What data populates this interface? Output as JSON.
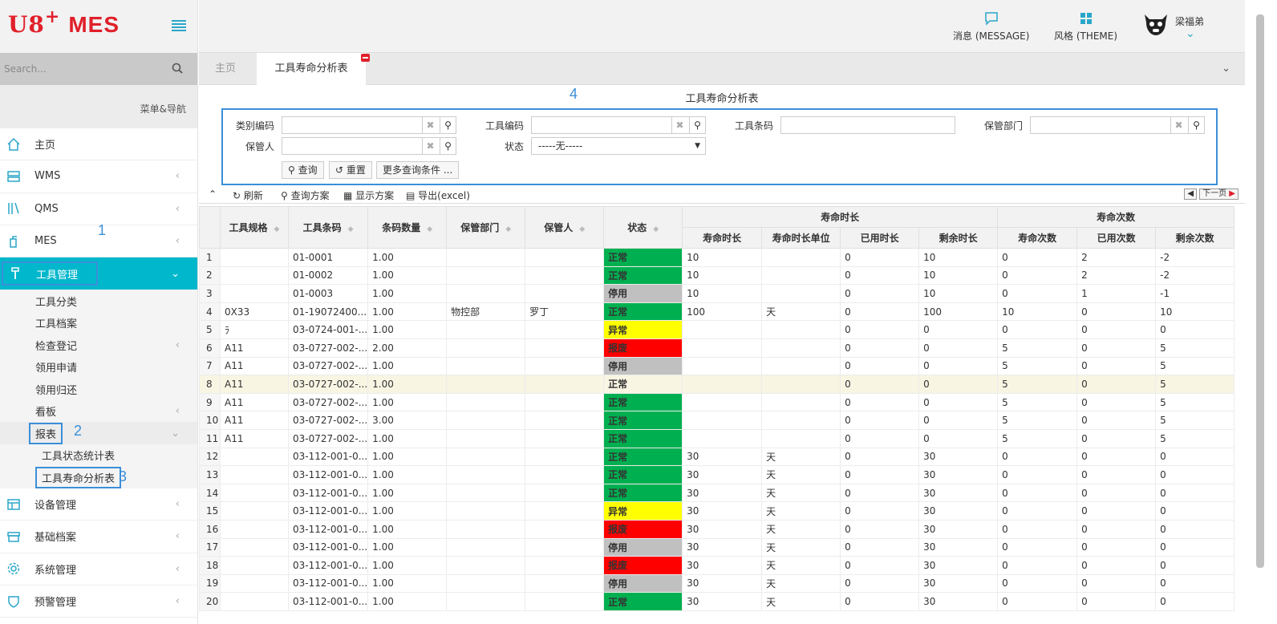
{
  "brand": {
    "logo": "U8",
    "plus": "+",
    "mes": "MES"
  },
  "search": {
    "placeholder": "Search..."
  },
  "nav_header": "菜单&导航",
  "nav": {
    "home": "主页",
    "wms": "WMS",
    "qms": "QMS",
    "mes": "MES",
    "tools": "工具管理",
    "tools_sub": {
      "category": "工具分类",
      "archive": "工具档案",
      "inspect": "检查登记",
      "apply": "领用申请",
      "return": "领用归还",
      "board": "看板",
      "report": "报表",
      "status_report": "工具状态统计表",
      "life_report": "工具寿命分析表"
    },
    "equipment": "设备管理",
    "basic": "基础档案",
    "system": "系统管理",
    "alert": "预警管理"
  },
  "annotations": {
    "a1": "1",
    "a2": "2",
    "a3": "3",
    "a4": "4"
  },
  "header": {
    "message": "消息 (MESSAGE)",
    "theme": "风格 (THEME)",
    "user": "梁福弟"
  },
  "tabs": {
    "home": "主页",
    "current": "工具寿命分析表"
  },
  "report": {
    "title": "工具寿命分析表",
    "filters": {
      "category_code": "类别编码",
      "tool_code": "工具编码",
      "tool_barcode": "工具条码",
      "dept": "保管部门",
      "keeper": "保管人",
      "status": "状态",
      "status_value": "-----无-----"
    },
    "buttons": {
      "query": "查询",
      "reset": "重置",
      "more": "更多查询条件 ..."
    },
    "toolbar": {
      "refresh": "刷新",
      "query_plan": "查询方案",
      "display_plan": "显示方案",
      "export": "导出(excel)",
      "next_page": "下一页"
    }
  },
  "grid": {
    "headers": {
      "spec": "工具规格",
      "barcode": "条码",
      "qty": "条码数量",
      "dept": "保管部门",
      "keeper": "保管人",
      "status": "状态",
      "life_time_group": "寿命时长",
      "life_count_group": "寿命次数",
      "life_time": "寿命时长",
      "life_unit": "寿命时长单位",
      "used_time": "已用时长",
      "remain_time": "剩余时长",
      "life_count": "寿命次数",
      "used_count": "已用次数",
      "remain_count": "剩余次数",
      "barcode_full": "工具条码"
    },
    "status_colors": {
      "正常": "#00b050",
      "停用": "#c0c0c0",
      "异常": "#ffff00",
      "报废": "#ff0000"
    },
    "rows": [
      [
        "1",
        "",
        "01-0001",
        "1.00",
        "",
        "",
        "正常",
        "10",
        "",
        "0",
        "10",
        "0",
        "2",
        "-2"
      ],
      [
        "2",
        "",
        "01-0002",
        "1.00",
        "",
        "",
        "正常",
        "10",
        "",
        "0",
        "10",
        "0",
        "2",
        "-2"
      ],
      [
        "3",
        "",
        "01-0003",
        "1.00",
        "",
        "",
        "停用",
        "10",
        "",
        "0",
        "10",
        "0",
        "1",
        "-1"
      ],
      [
        "4",
        "0X33",
        "01-19072400...",
        "1.00",
        "物控部",
        "罗丁",
        "正常",
        "100",
        "天",
        "0",
        "100",
        "10",
        "0",
        "10"
      ],
      [
        "5",
        "ﾗ",
        "03-0724-001-...",
        "1.00",
        "",
        "",
        "异常",
        "",
        "",
        "0",
        "0",
        "0",
        "0",
        "0"
      ],
      [
        "6",
        "A11",
        "03-0727-002-...",
        "2.00",
        "",
        "",
        "报废",
        "",
        "",
        "0",
        "0",
        "5",
        "0",
        "5"
      ],
      [
        "7",
        "A11",
        "03-0727-002-...",
        "1.00",
        "",
        "",
        "停用",
        "",
        "",
        "0",
        "0",
        "5",
        "0",
        "5"
      ],
      [
        "8",
        "A11",
        "03-0727-002-...",
        "1.00",
        "",
        "",
        "正常",
        "",
        "",
        "0",
        "0",
        "5",
        "0",
        "5"
      ],
      [
        "9",
        "A11",
        "03-0727-002-...",
        "1.00",
        "",
        "",
        "正常",
        "",
        "",
        "0",
        "0",
        "5",
        "0",
        "5"
      ],
      [
        "10",
        "A11",
        "03-0727-002-...",
        "3.00",
        "",
        "",
        "正常",
        "",
        "",
        "0",
        "0",
        "5",
        "0",
        "5"
      ],
      [
        "11",
        "A11",
        "03-0727-002-...",
        "1.00",
        "",
        "",
        "正常",
        "",
        "",
        "0",
        "0",
        "5",
        "0",
        "5"
      ],
      [
        "12",
        "",
        "03-112-001-0...",
        "1.00",
        "",
        "",
        "正常",
        "30",
        "天",
        "0",
        "30",
        "0",
        "0",
        "0"
      ],
      [
        "13",
        "",
        "03-112-001-0...",
        "1.00",
        "",
        "",
        "正常",
        "30",
        "天",
        "0",
        "30",
        "0",
        "0",
        "0"
      ],
      [
        "14",
        "",
        "03-112-001-0...",
        "1.00",
        "",
        "",
        "正常",
        "30",
        "天",
        "0",
        "30",
        "0",
        "0",
        "0"
      ],
      [
        "15",
        "",
        "03-112-001-0...",
        "1.00",
        "",
        "",
        "异常",
        "30",
        "天",
        "0",
        "30",
        "0",
        "0",
        "0"
      ],
      [
        "16",
        "",
        "03-112-001-0...",
        "1.00",
        "",
        "",
        "报废",
        "30",
        "天",
        "0",
        "30",
        "0",
        "0",
        "0"
      ],
      [
        "17",
        "",
        "03-112-001-0...",
        "1.00",
        "",
        "",
        "停用",
        "30",
        "天",
        "0",
        "30",
        "0",
        "0",
        "0"
      ],
      [
        "18",
        "",
        "03-112-001-0...",
        "1.00",
        "",
        "",
        "报废",
        "30",
        "天",
        "0",
        "30",
        "0",
        "0",
        "0"
      ],
      [
        "19",
        "",
        "03-112-001-0...",
        "1.00",
        "",
        "",
        "停用",
        "30",
        "天",
        "0",
        "30",
        "0",
        "0",
        "0"
      ],
      [
        "20",
        "",
        "03-112-001-0...",
        "1.00",
        "",
        "",
        "正常",
        "30",
        "天",
        "0",
        "30",
        "0",
        "0",
        "0"
      ]
    ]
  }
}
